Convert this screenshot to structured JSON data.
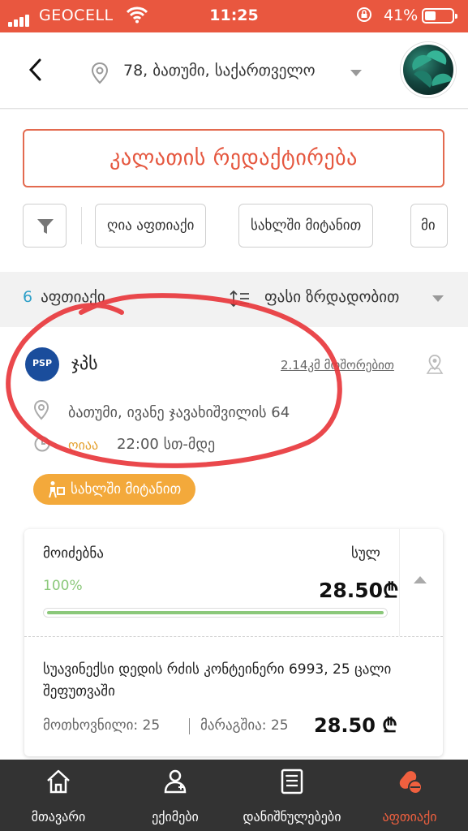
{
  "status_bar": {
    "carrier": "GEOCELL",
    "time": "11:25",
    "battery": "41%"
  },
  "header": {
    "location": "78, ბათუმი, საქართველო"
  },
  "edit_button": "კალათის რედაქტირება",
  "filters": [
    "ღია აფთიაქი",
    "სახლში მიტანით",
    "მი"
  ],
  "sort_bar": {
    "count": "6",
    "count_label": "აფთიაქი",
    "sort_label": "ფასი ზრდადობით"
  },
  "pharmacy": {
    "logo_text": "PSP",
    "name": "ჯპს",
    "distance": "2.14კმ მოშორებით",
    "address": "ბათუმი, ივანე ჯავახიშვილის 64",
    "open_label": "ღიაა",
    "hours": "22:00 სთ-მდე",
    "delivery_label": "სახლში მიტანით"
  },
  "order": {
    "availability_label": "მოიძებნა",
    "total_label": "სულ",
    "percent": "100%",
    "progress": 1.0,
    "total": "28.50₾",
    "item_name": "სუავინექსი დედის რძის კონტეინერი 6993, 25 ცალი შეფუთვაში",
    "requested": "მოთხოვნილი: 25",
    "in_stock": "მარაგშია: 25",
    "price": "28.50 ₾"
  },
  "tabs": [
    {
      "label": "მთავარი",
      "icon": "home-icon",
      "active": false
    },
    {
      "label": "ექიმები",
      "icon": "doctor-icon",
      "active": false
    },
    {
      "label": "დანიშნულებები",
      "icon": "prescription-icon",
      "active": false
    },
    {
      "label": "აფთიაქი",
      "icon": "pharmacy-pills-icon",
      "active": true
    }
  ],
  "colors": {
    "accent": "#e9573f",
    "delivery": "#f3a93b",
    "success": "#8bc87a",
    "tabbar": "#333333"
  }
}
